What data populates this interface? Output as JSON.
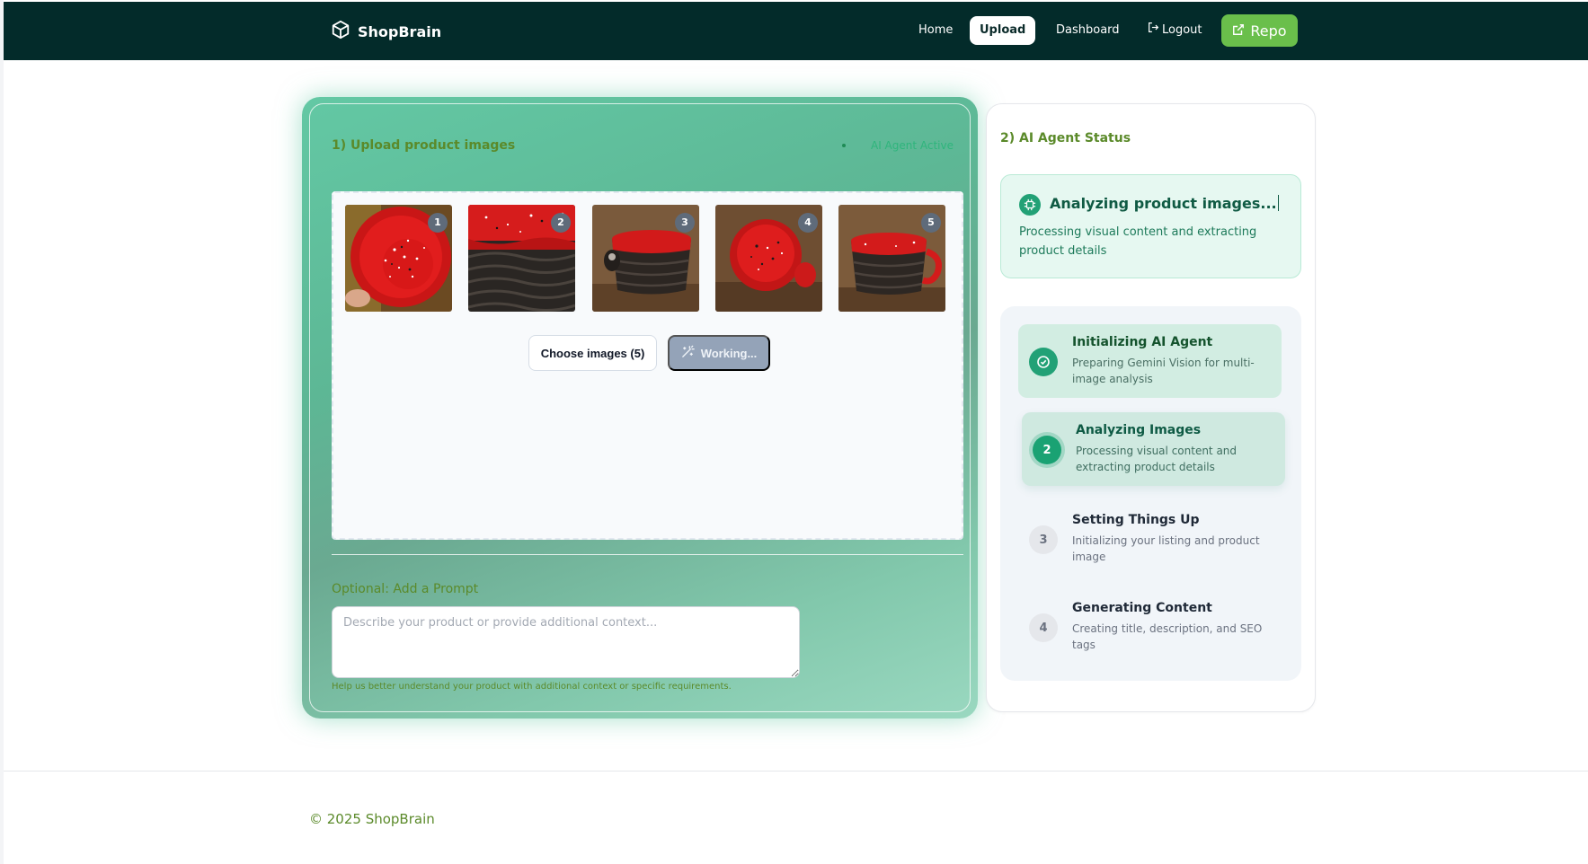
{
  "nav": {
    "brand": "ShopBrain",
    "links": {
      "home": "Home",
      "upload": "Upload",
      "dashboard": "Dashboard",
      "logout": "Logout"
    },
    "repo": "Repo"
  },
  "upload": {
    "title": "1) Upload product images",
    "agent_status": "AI Agent Active",
    "thumbnails": [
      {
        "badge": "1",
        "view": "bowl-top"
      },
      {
        "badge": "2",
        "view": "rim-closeup"
      },
      {
        "badge": "3",
        "view": "mug-side-left"
      },
      {
        "badge": "4",
        "view": "bowl-angle"
      },
      {
        "badge": "5",
        "view": "mug-side-right"
      }
    ],
    "choose_button": "Choose images (5)",
    "working_button": "Working...",
    "prompt_label": "Optional: Add a Prompt",
    "prompt_placeholder": "Describe your product or provide additional context...",
    "prompt_help": "Help us better understand your product with additional context or specific requirements."
  },
  "status": {
    "title": "2) AI Agent Status",
    "current_heading": "Analyzing product images...",
    "current_sub": "Processing visual content and extracting product details",
    "steps": [
      {
        "marker": "",
        "state": "done",
        "title": "Initializing AI Agent",
        "desc": "Preparing Gemini Vision for multi-image analysis"
      },
      {
        "marker": "2",
        "state": "active",
        "title": "Analyzing Images",
        "desc": "Processing visual content and extracting product details"
      },
      {
        "marker": "3",
        "state": "pending",
        "title": "Setting Things Up",
        "desc": "Initializing your listing and product image"
      },
      {
        "marker": "4",
        "state": "pending",
        "title": "Generating Content",
        "desc": "Creating title, description, and SEO tags"
      }
    ]
  },
  "footer": {
    "copyright": "© 2025 ShopBrain"
  },
  "colors": {
    "nav_bg": "#032b2a",
    "accent": "#22a176",
    "repo_bg": "#6abf4b",
    "label_green": "#5b8a2a"
  }
}
